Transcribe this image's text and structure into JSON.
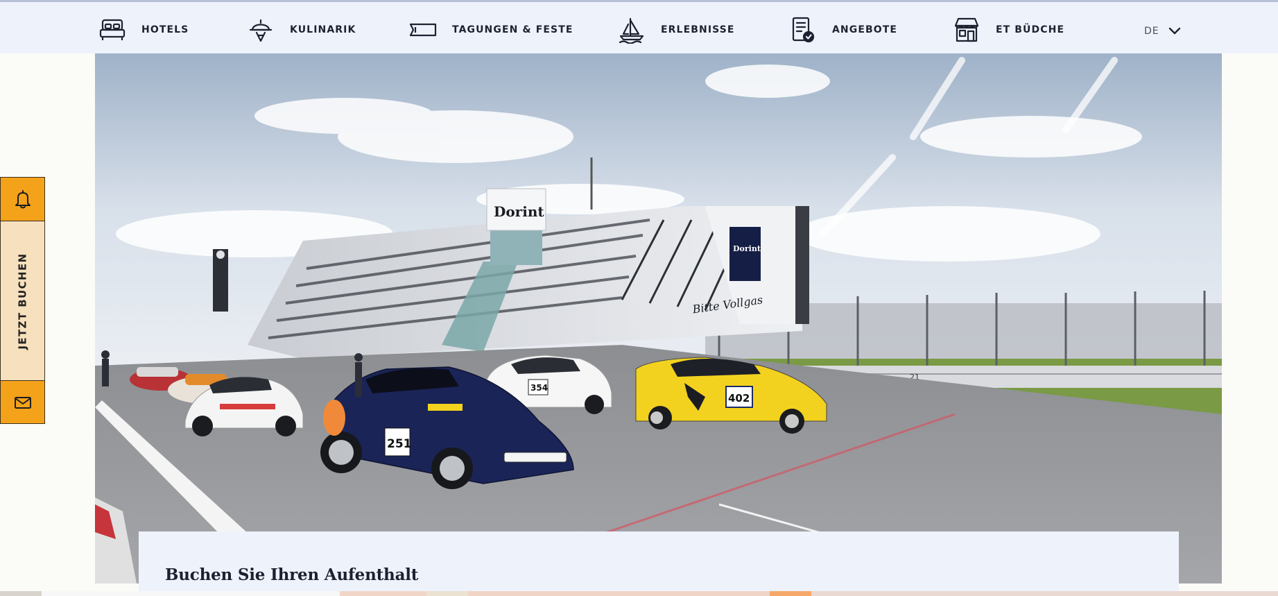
{
  "nav": {
    "items": [
      {
        "label": "HOTELS",
        "icon": "bed-icon"
      },
      {
        "label": "KULINARIK",
        "icon": "chef-hat-icon"
      },
      {
        "label": "TAGUNGEN & FESTE",
        "icon": "ticket-icon"
      },
      {
        "label": "ERLEBNISSE",
        "icon": "sailboat-icon"
      },
      {
        "label": "ANGEBOTE",
        "icon": "offer-list-icon"
      },
      {
        "label": "ET BÜDCHE",
        "icon": "kiosk-icon"
      }
    ],
    "language": "DE"
  },
  "hero": {
    "building_sign": "Dorint",
    "banner_text": "Bitte Vollgas",
    "car_numbers": [
      "251",
      "354",
      "402"
    ],
    "track_number": "21"
  },
  "side": {
    "book_label": "JETZT BUCHEN"
  },
  "booking": {
    "title": "Buchen Sie Ihren Aufenthalt"
  },
  "colors": {
    "accent": "#f4a21a",
    "accent_light": "#f7e0bd",
    "nav_bg": "#eef2fb",
    "text": "#1d2130"
  }
}
